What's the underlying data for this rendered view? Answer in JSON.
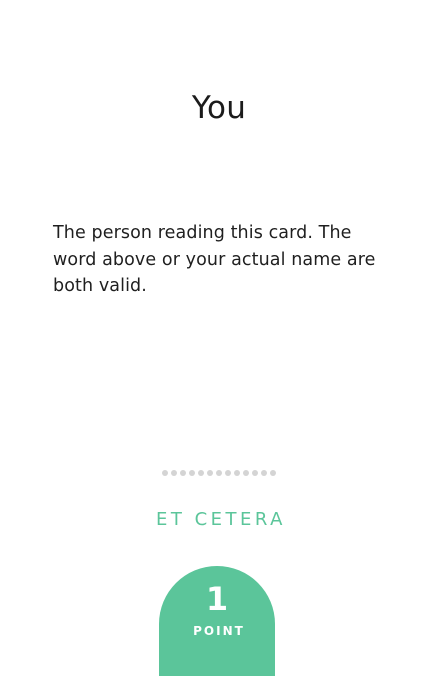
{
  "card": {
    "title": "You",
    "description": "The person reading this card. The word above or your actual name are both valid.",
    "divider_dot_count": 13,
    "category": "ET CETERA",
    "points": {
      "value": "1",
      "unit": "POINT"
    }
  },
  "colors": {
    "accent": "#5bc59a",
    "text": "#1b1b1b",
    "dots": "#d4d4d4",
    "background": "#ffffff"
  }
}
